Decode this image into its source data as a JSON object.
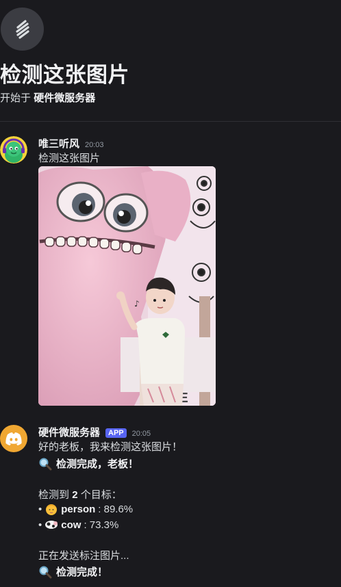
{
  "thread": {
    "title": "检测这张图片",
    "started_prefix": "开始于",
    "server": "硬件微服务器",
    "icon": "thread-icon"
  },
  "messages": [
    {
      "author": "唯三听风",
      "time": "20:03",
      "text": "检测这张图片",
      "attachment": {
        "type": "image",
        "description_icon": "photo"
      }
    },
    {
      "author": "硬件微服务器",
      "badge": "APP",
      "time": "20:05",
      "lines": {
        "l1": "好的老板，我来检测这张图片！",
        "l2": "检测完成，老板！",
        "l3_prefix": "检测到",
        "l3_count": "2",
        "l3_suffix": "个目标：",
        "d1_label": "person",
        "d1_value": ": 89.6%",
        "d2_label": "cow",
        "d2_value": ": 73.3%",
        "l4": "正在发送标注图片...",
        "l5": "检测完成！"
      },
      "bullet": "•"
    }
  ],
  "colors": {
    "accent": "#5865f2",
    "bg": "#1a1a1e",
    "discord_orange": "#f0a732"
  }
}
